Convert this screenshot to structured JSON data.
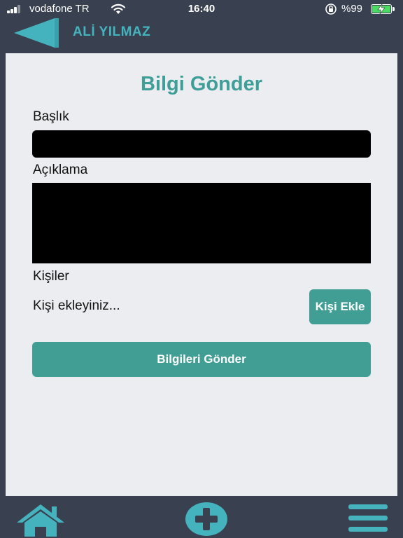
{
  "status_bar": {
    "carrier": "vodafone TR",
    "time": "16:40",
    "battery": "%99"
  },
  "header": {
    "user_name": "ALİ YILMAZ",
    "back_icon": "back-arrow-icon"
  },
  "form": {
    "title": "Bilgi Gönder",
    "title_label": "Başlık",
    "title_value": "",
    "description_label": "Açıklama",
    "description_value": "",
    "people_label": "Kişiler",
    "people_hint": "Kişi ekleyiniz...",
    "add_person_label": "Kişi Ekle",
    "submit_label": "Bilgileri Gönder"
  },
  "bottom_nav": {
    "items": [
      "home-icon",
      "add-circle-icon",
      "menu-icon"
    ]
  },
  "colors": {
    "background": "#39404f",
    "panel": "#ecedf1",
    "accent": "#409e95",
    "accent_light": "#45b3bd"
  }
}
